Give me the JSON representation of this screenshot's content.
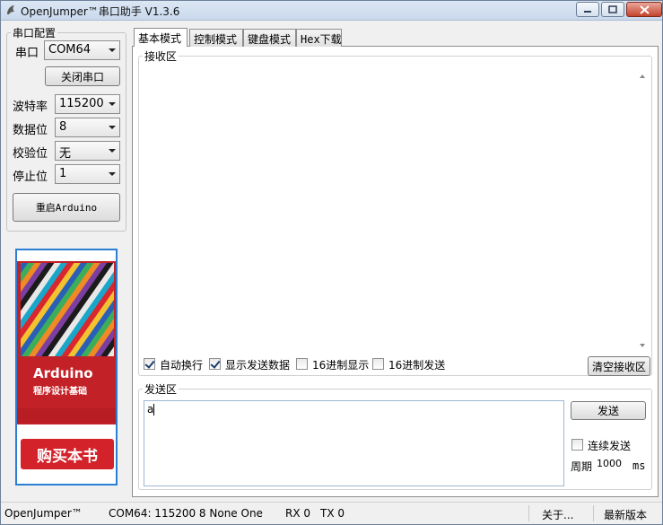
{
  "window": {
    "title": "OpenJumper™串口助手  V1.3.6"
  },
  "serial_config": {
    "group_title": "串口配置",
    "port_label": "串口",
    "port_value": "COM64",
    "close_button": "关闭串口",
    "baud_label": "波特率",
    "baud_value": "115200",
    "databits_label": "数据位",
    "databits_value": "8",
    "parity_label": "校验位",
    "parity_value": "无",
    "stopbits_label": "停止位",
    "stopbits_value": "1",
    "restart_button": "重启Arduino"
  },
  "ad": {
    "book_title": "Arduino",
    "book_subtitle": "程序设计基础",
    "buy_button": "购买本书"
  },
  "tabs": [
    "基本模式",
    "控制模式",
    "键盘模式",
    "Hex下载"
  ],
  "receive": {
    "title": "接收区",
    "content": "",
    "auto_newline": "自动换行",
    "show_sent": "显示发送数据",
    "hex_display": "16进制显示",
    "hex_send": "16进制发送",
    "clear_button": "清空接收区",
    "auto_newline_checked": true,
    "show_sent_checked": true,
    "hex_display_checked": false,
    "hex_send_checked": false
  },
  "send": {
    "title": "发送区",
    "content": "a",
    "send_button": "发送",
    "continuous_label": "连续发送",
    "continuous_checked": false,
    "period_label": "周期",
    "period_value": "1000",
    "period_unit": "ms"
  },
  "statusbar": {
    "brand": "OpenJumper™",
    "port_info": "COM64: 115200 8 None One",
    "rx": "RX  0",
    "tx": "TX  0",
    "about": "关于...",
    "latest": "最新版本"
  }
}
